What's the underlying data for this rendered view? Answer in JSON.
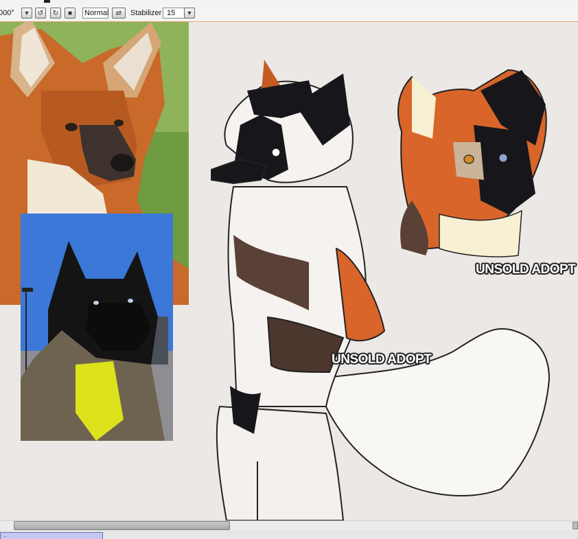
{
  "toolbar": {
    "rotation": "000°",
    "rotate_left_icon": "rotate-left-icon",
    "rotate_right_icon": "rotate-right-icon",
    "reset_icon": "reset-view-icon",
    "blend_mode": "Normal",
    "flip_icon": "flip-horizontal-icon",
    "stabilizer_label": "Stabilizer",
    "stabilizer_value": "15"
  },
  "canvas": {
    "labels": [
      "UNSOLD ADOPT",
      "UNSOLD ADOPT"
    ]
  },
  "colors": {
    "canvas_bg": "#ece8e6",
    "toolbar_accent": "#e8a070",
    "fur_orange": "#d9652a",
    "fur_black": "#17171b",
    "fur_cream": "#f7f0d2",
    "fur_brown": "#5a4136"
  },
  "tabs": {
    "doc_label": "..."
  }
}
